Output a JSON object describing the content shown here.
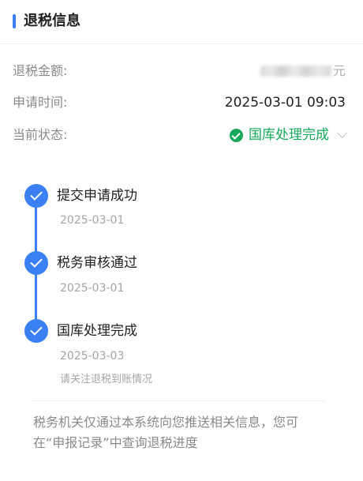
{
  "header": {
    "title": "退税信息"
  },
  "info": {
    "amount_label": "退税金额:",
    "amount_unit": "元",
    "time_label": "申请时间:",
    "time_value": "2025-03-01 09:03",
    "status_label": "当前状态:",
    "status_value": "国库处理完成"
  },
  "timeline": {
    "steps": [
      {
        "title": "提交申请成功",
        "date": "2025-03-01"
      },
      {
        "title": "税务审核通过",
        "date": "2025-03-01"
      },
      {
        "title": "国库处理完成",
        "date": "2025-03-03",
        "note": "请关注退税到账情况"
      }
    ]
  },
  "notice": "税务机关仅通过本系统向您推送相关信息，您可在“申报记录”中查询退税进度",
  "colors": {
    "accent": "#3b7ff5",
    "success": "#15a85a"
  }
}
